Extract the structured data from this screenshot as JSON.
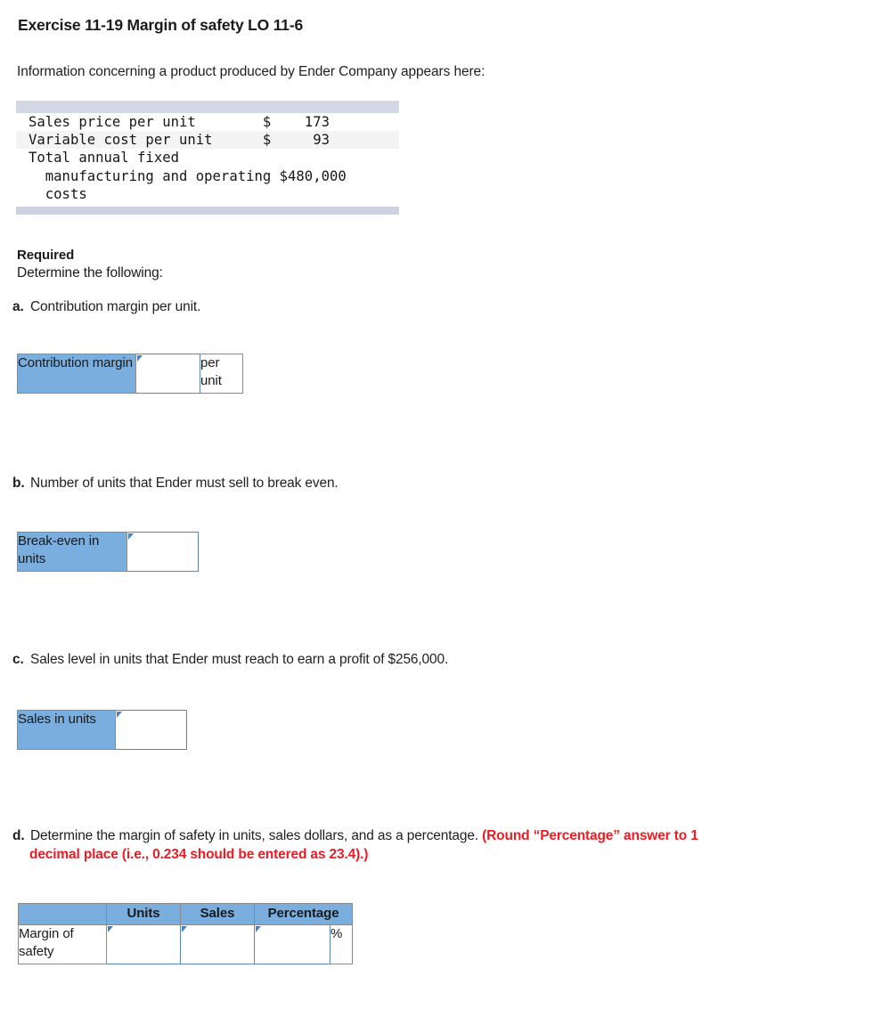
{
  "exercise": {
    "title": "Exercise 11-19 Margin of safety LO 11-6",
    "intro": "Information concerning a product produced by Ender Company appears here:"
  },
  "info_table": {
    "rows": [
      {
        "label": "Sales price per unit",
        "currency": "$",
        "value": "173"
      },
      {
        "label": "Variable cost per unit",
        "currency": "$",
        "value": "93"
      },
      {
        "label": "Total annual fixed",
        "currency": "",
        "value": ""
      },
      {
        "label": "  manufacturing and operating",
        "currency": "",
        "value": "$480,000"
      },
      {
        "label": "  costs",
        "currency": "",
        "value": ""
      }
    ],
    "line_a": "Sales price per unit        $    173",
    "line_b": "Variable cost per unit      $     93",
    "line_c": "Total annual fixed",
    "line_d": "  manufacturing and operating $480,000",
    "line_e": "  costs"
  },
  "required": {
    "heading": "Required",
    "subheading": "Determine the following:"
  },
  "questions": {
    "a": {
      "marker": "a.",
      "text": "Contribution margin per unit."
    },
    "b": {
      "marker": "b.",
      "text": "Number of units that Ender must sell to break even."
    },
    "c": {
      "marker": "c.",
      "text": "Sales level in units that Ender must reach to earn a profit of $256,000."
    },
    "d": {
      "marker": "d.",
      "text": "Determine the margin of safety in units, sales dollars, and as a percentage. ",
      "note_line1": "(Round “Percentage” answer to 1",
      "note_line2": "decimal place (i.e., 0.234 should be entered as 23.4).)"
    }
  },
  "answers": {
    "a": {
      "label": "Contribution margin",
      "value": "",
      "unit": "per unit"
    },
    "b": {
      "label": "Break-even in units",
      "value": ""
    },
    "c": {
      "label": "Sales in units",
      "value": ""
    },
    "d": {
      "row_label": "Margin of safety",
      "corner": "",
      "columns": [
        "Units",
        "Sales",
        "Percentage"
      ],
      "values": [
        "",
        "",
        ""
      ],
      "percent_symbol": "%"
    }
  },
  "colors": {
    "header_blue": "#7aaede",
    "band_blue_grey": "#d2d8e4",
    "zebra_grey": "#f4f4f4",
    "red_note": "#ed1c24",
    "input_border": "#5f87b5",
    "cell_border": "#8a8a8a"
  }
}
